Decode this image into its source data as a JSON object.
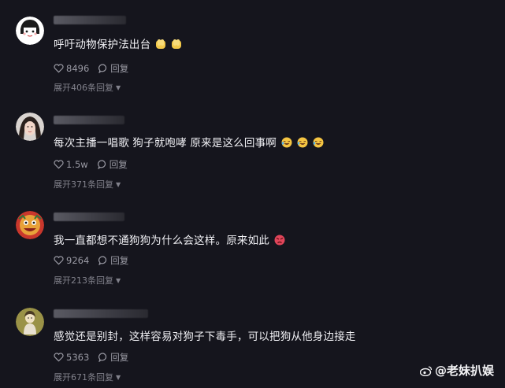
{
  "comments": [
    {
      "text": "呼吁动物保护法出台",
      "likes": "8496",
      "reply_label": "回复",
      "expand_label": "展开406条回复",
      "emojis": [
        "pray",
        "pray"
      ]
    },
    {
      "text": "每次主播一唱歌 狗子就咆哮 原来是这么回事啊",
      "likes": "1.5w",
      "reply_label": "回复",
      "expand_label": "展开371条回复",
      "emojis": [
        "laugh-cry",
        "laugh-cry",
        "laugh-cry"
      ]
    },
    {
      "text": "我一直都想不通狗狗为什么会这样。原来如此",
      "likes": "9264",
      "reply_label": "回复",
      "expand_label": "展开213条回复",
      "emojis": [
        "angry"
      ]
    },
    {
      "text": "感觉还是别封，这样容易对狗子下毒手，可以把狗从他身边接走",
      "likes": "5363",
      "reply_label": "回复",
      "expand_label": "展开671条回复",
      "emojis": []
    }
  ],
  "watermark": "@老妹扒娱",
  "colors": {
    "background": "#15151d",
    "text": "#f0f0f4",
    "muted": "#9a9aa4"
  }
}
